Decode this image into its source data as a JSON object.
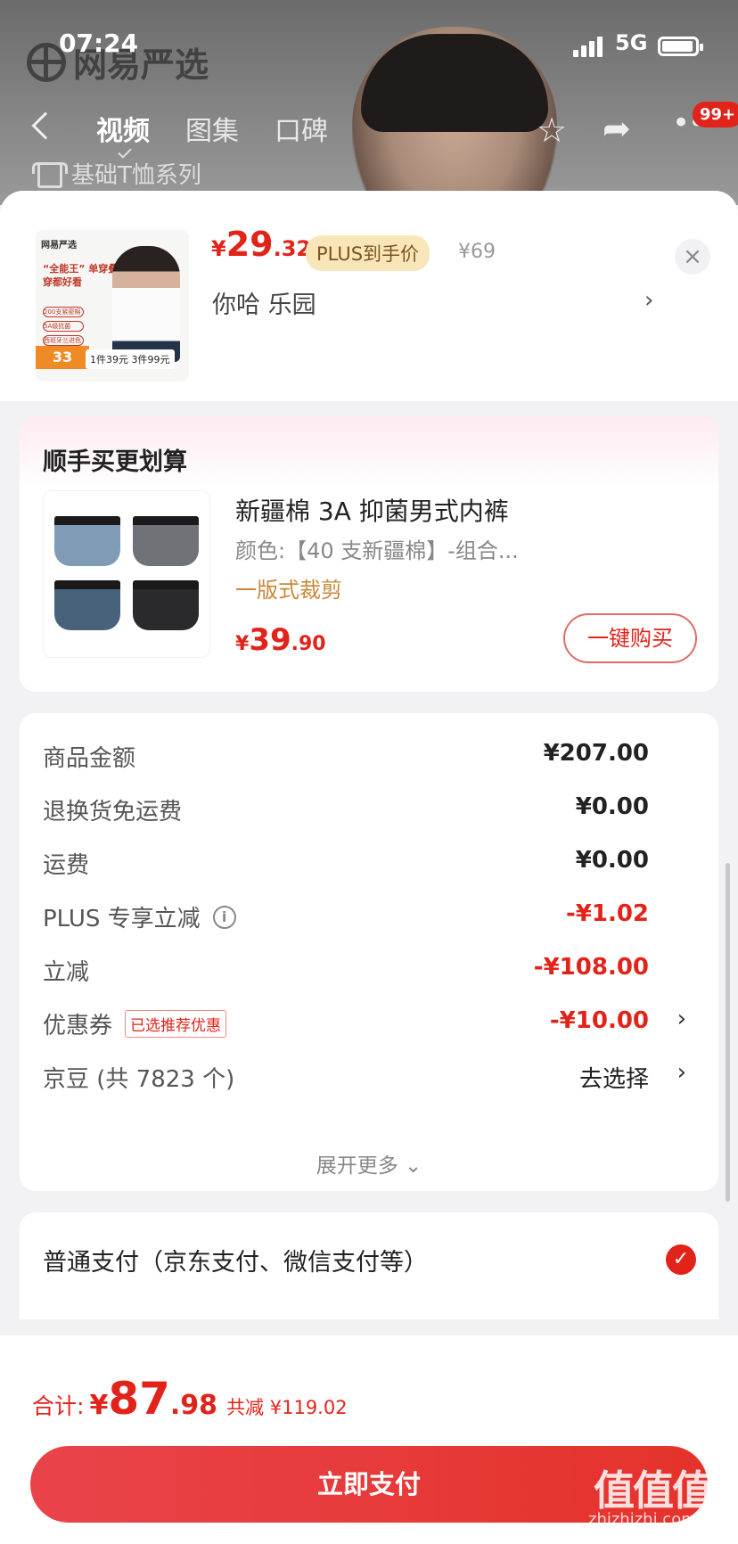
{
  "status_bar": {
    "time": "07:24",
    "network": "5G"
  },
  "background_page": {
    "brand": "网易严选",
    "tabs": [
      "视频",
      "图集",
      "口碑"
    ],
    "active_tab": "视频",
    "badge": "99+",
    "series": "基础T恤系列"
  },
  "product": {
    "thumb": {
      "brand": "网易严选",
      "headline": "“全能王” 单穿叠穿都好看",
      "features": [
        "200支紧密棉",
        "5A级抗菌",
        "西班牙兰进色"
      ],
      "badge": "33",
      "promo": "1件39元 3件99元"
    },
    "price": {
      "yen": "¥",
      "int": "29",
      "dec": ".32"
    },
    "plus_tag": "PLUS到手价",
    "original_price": "¥69",
    "spec": "你哈  乐园",
    "close": "×"
  },
  "addon": {
    "title": "顺手买更划算",
    "name": "新疆棉 3A 抑菌男式内裤",
    "spec": "颜色:【40 支新疆棉】-组合...",
    "tag": "一版式裁剪",
    "price": {
      "yen": "¥",
      "int": "39",
      "dec": ".90"
    },
    "buy_label": "一键购买"
  },
  "amounts": {
    "rows": [
      {
        "label": "商品金额",
        "value": "¥207.00"
      },
      {
        "label": "退换货免运费",
        "value": "¥0.00"
      },
      {
        "label": "运费",
        "value": "¥0.00"
      },
      {
        "label": "PLUS 专享立减",
        "value": "-¥1.02"
      },
      {
        "label": "立减",
        "value": "-¥108.00"
      },
      {
        "label": "优惠券",
        "value": "-¥10.00",
        "tag": "已选推荐优惠"
      },
      {
        "label": "京豆 (共 7823 个)",
        "value": "去选择"
      }
    ],
    "expand_label": "展开更多 ⌄"
  },
  "payment": {
    "method": "普通支付（京东支付、微信支付等）"
  },
  "footer": {
    "total_label": "合计:",
    "total": {
      "yen": "¥",
      "int": "87",
      "dec": ".98"
    },
    "saved": "共减 ¥119.02",
    "pay_button": "立即支付"
  },
  "watermark": {
    "main": "值值值",
    "sub": "zhizhizhi.com"
  },
  "colors": {
    "accent": "#e2231a",
    "plus_gold": "#f9e6b8",
    "tag_gold": "#c8883a"
  }
}
